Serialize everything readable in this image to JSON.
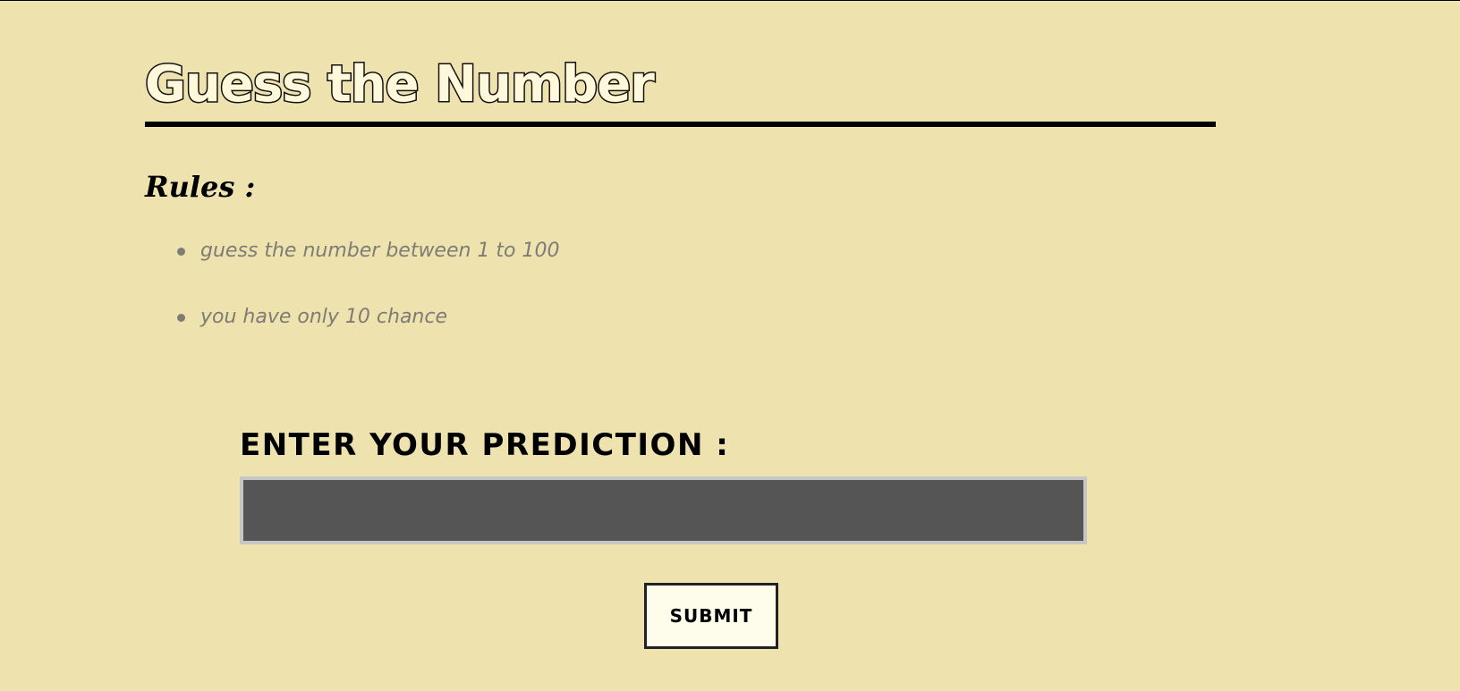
{
  "page": {
    "title": "Guess the Number",
    "rules_heading": "Rules :",
    "rules": [
      "guess the number between 1 to 100",
      "you have only 10 chance"
    ],
    "prediction_label": "ENTER YOUR PREDICTION :",
    "prediction_input": {
      "value": "",
      "placeholder": ""
    },
    "submit_label": "SUBMIT"
  },
  "colors": {
    "background": "#EEE2AE",
    "title_fill": "#FFF8DA",
    "rule_text": "#7E7C74",
    "input_background": "#555555",
    "input_border": "#C6C6C6",
    "button_background": "#FEFDEB"
  }
}
